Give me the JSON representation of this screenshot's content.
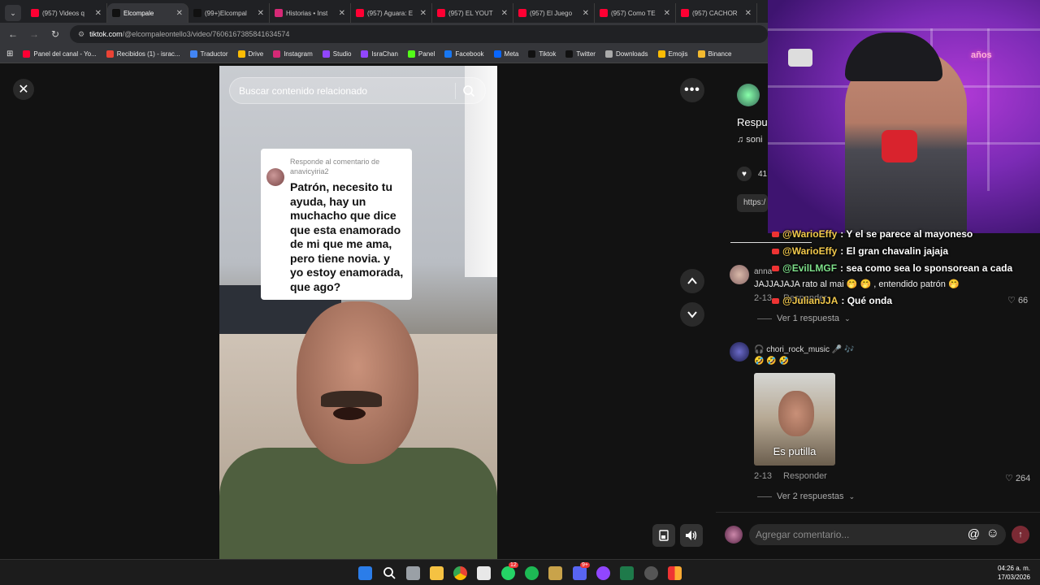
{
  "browser": {
    "tabs": [
      {
        "label": "(957) Videos q",
        "color": "#ff0033",
        "active": false
      },
      {
        "label": "Elcompale",
        "color": "#111111",
        "active": true
      },
      {
        "label": "(99+)Elcompal",
        "color": "#111111",
        "active": false
      },
      {
        "label": "Historias • Inst",
        "color": "#d62976",
        "active": false
      },
      {
        "label": "(957) Aguara: E",
        "color": "#ff0033",
        "active": false
      },
      {
        "label": "(957) EL YOUT",
        "color": "#ff0033",
        "active": false
      },
      {
        "label": "(957) El Juego",
        "color": "#ff0033",
        "active": false
      },
      {
        "label": "(957) Como TE",
        "color": "#ff0033",
        "active": false
      },
      {
        "label": "(957) CACHOR",
        "color": "#ff0033",
        "active": false
      }
    ],
    "url_host": "tiktok.com",
    "url_path": "/@elcompaleontello3/video/760616738584163457​4",
    "bookmarks": [
      {
        "label": "Panel del canal - Yo...",
        "color": "#ff0033"
      },
      {
        "label": "Recibidos (1) - israc...",
        "color": "#ea4335"
      },
      {
        "label": "Traductor",
        "color": "#4285f4"
      },
      {
        "label": "Drive",
        "color": "#fbbc04"
      },
      {
        "label": "Instagram",
        "color": "#d62976"
      },
      {
        "label": "Studio",
        "color": "#9146ff"
      },
      {
        "label": "IsraChan",
        "color": "#9146ff"
      },
      {
        "label": "Panel",
        "color": "#53fc18"
      },
      {
        "label": "Facebook",
        "color": "#1877f2"
      },
      {
        "label": "Meta",
        "color": "#0866ff"
      },
      {
        "label": "Tiktok",
        "color": "#111111"
      },
      {
        "label": "Twitter",
        "color": "#111111"
      },
      {
        "label": "Downloads",
        "color": "#aaaaaa"
      },
      {
        "label": "Emojis",
        "color": "#fbbc04"
      },
      {
        "label": "Binance",
        "color": "#f3ba2f"
      }
    ]
  },
  "video": {
    "search_placeholder": "Buscar contenido relacionado",
    "reply_heading": "Responde al comentario de anavicyiria2",
    "reply_text": "Patrón, necesito tu ayuda, hay un muchacho que dice que esta enamorado de mi que me ama, pero tiene novia. y yo estoy enamorada, que ago?"
  },
  "side": {
    "partial_reply": "Respue",
    "partial_sound": "♫ soni",
    "partial_likes": "41",
    "partial_url": "https:/"
  },
  "chat_overlay": [
    {
      "user": "@WarioEffy",
      "text": ": Y el se parece al mayoneso",
      "user_color": "#f2c94c"
    },
    {
      "user": "@WarioEffy",
      "text": ": El gran chavalin jajaja",
      "user_color": "#f2c94c"
    },
    {
      "user": "@EvilLMGF",
      "text": ": sea como sea lo sponsorean a cada",
      "user_color": "#7ee08a"
    },
    {
      "user": "@JulianJJA",
      "text": ": Qué onda",
      "user_color": "#f2c94c"
    }
  ],
  "comments": [
    {
      "author": "anna",
      "text": "JAJJAJAJA rato al mai 🤭 🤭 , entendido patrón 🤭",
      "date": "2-13",
      "reply_label": "Responder",
      "likes": "66",
      "more": "Ver 1 respuesta"
    },
    {
      "author": "🎧 chori_rock_music 🎤 🎶",
      "emojis": "🤣 🤣 🤣",
      "sticker_caption": "Es putilla",
      "date": "2-13",
      "reply_label": "Responder",
      "likes": "264",
      "more": "Ver 2 respuestas"
    }
  ],
  "comment_input": {
    "placeholder": "Agregar comentario..."
  },
  "taskbar": {
    "time": "04:26 a. m.",
    "date": "17/03/2026",
    "badges": {
      "whatsapp": "12",
      "discord": "9+"
    }
  }
}
